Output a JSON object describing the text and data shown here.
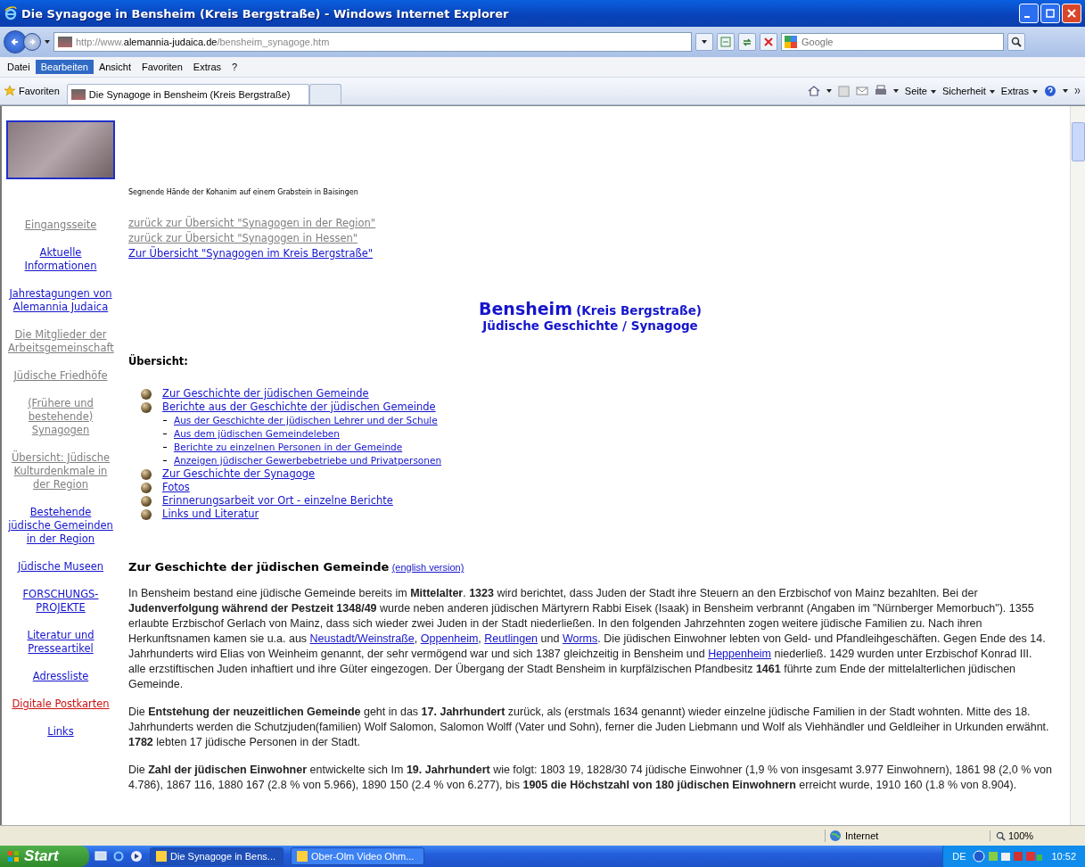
{
  "window": {
    "title": "Die Synagoge in Bensheim (Kreis Bergstraße) - Windows Internet Explorer"
  },
  "address": {
    "prefix": "http://www.",
    "domain": "alemannia-judaica.de",
    "path": "/bensheim_synagoge.htm"
  },
  "search": {
    "placeholder": "Google"
  },
  "menu": [
    {
      "label": "Datei",
      "selected": false
    },
    {
      "label": "Bearbeiten",
      "selected": true
    },
    {
      "label": "Ansicht",
      "selected": false
    },
    {
      "label": "Favoriten",
      "selected": false
    },
    {
      "label": "Extras",
      "selected": false
    },
    {
      "label": "?",
      "selected": false
    }
  ],
  "favorites": {
    "label": "Favoriten",
    "tab": "Die Synagoge in Bensheim (Kreis Bergstraße)"
  },
  "command_bar": [
    "Seite",
    "Sicherheit",
    "Extras"
  ],
  "sidebar": {
    "items": [
      {
        "label": "Eingangsseite",
        "color": "#808080"
      },
      {
        "label": "Aktuelle Informationen",
        "color": "#1515cc"
      },
      {
        "label": "Jahrestagungen von Alemannia Judaica",
        "color": "#1515cc"
      },
      {
        "label": "Die Mitglieder der Arbeitsgemeinschaft",
        "color": "#808080"
      },
      {
        "label": "Jüdische Friedhöfe",
        "color": "#808080"
      },
      {
        "label": "(Frühere und bestehende) Synagogen",
        "color": "#808080"
      },
      {
        "label": "Übersicht: Jüdische Kulturdenkmale in der Region",
        "color": "#808080"
      },
      {
        "label": "Bestehende jüdische Gemeinden in der Region",
        "color": "#1515cc"
      },
      {
        "label": "Jüdische Museen",
        "color": "#1515cc"
      },
      {
        "label": "FORSCHUNGS-PROJEKTE",
        "color": "#1515cc"
      },
      {
        "label": "Literatur und Presseartikel",
        "color": "#1515cc"
      },
      {
        "label": "Adressliste",
        "color": "#1515cc"
      },
      {
        "label": "Digitale Postkarten",
        "color": "#cc1111"
      },
      {
        "label": "Links",
        "color": "#1515cc"
      }
    ]
  },
  "photo_caption": "Segnende Hände der Kohanim auf einem Grabstein in Baisingen",
  "back_links": [
    {
      "label": "zurück zur Übersicht \"Synagogen in der Region\"",
      "color": "#808080"
    },
    {
      "label": "zurück zur Übersicht \"Synagogen in Hessen\"",
      "color": "#808080"
    },
    {
      "label": "Zur Übersicht \"Synagogen im Kreis Bergstraße\"",
      "color": "#1515cc"
    }
  ],
  "heading": {
    "title": "Bensheim",
    "district": "(Kreis Bergstraße)",
    "subtitle": "Jüdische Geschichte / Synagoge"
  },
  "overview": {
    "title": "Übersicht:",
    "items": [
      {
        "label": "Zur Geschichte der jüdischen Gemeinde"
      },
      {
        "label": "Berichte aus der Geschichte der jüdischen Gemeinde",
        "children": [
          {
            "label": "Aus der Geschichte der jüdischen Lehrer und der Schule"
          },
          {
            "label": "Aus dem jüdischen Gemeindeleben"
          },
          {
            "label": "Berichte zu einzelnen Personen in der Gemeinde"
          },
          {
            "label": "Anzeigen jüdischer Gewerbebetriebe und Privatpersonen"
          }
        ]
      },
      {
        "label": "Zur Geschichte der Synagoge"
      },
      {
        "label": "Fotos"
      },
      {
        "label": "Erinnerungsarbeit vor Ort - einzelne Berichte"
      },
      {
        "label": "Links und Literatur"
      }
    ]
  },
  "section": {
    "title": "Zur Geschichte der jüdischen Gemeinde",
    "link": "(english version)",
    "paragraphs": [
      [
        {
          "kind": "text",
          "text": "In Bensheim bestand eine jüdische Gemeinde bereits im **Mittelalter**. **1323** wird berichtet, dass Juden der Stadt ihre Steuern an den Erzbischof von Mainz bezahlten. Bei der **Judenverfolgung während der Pestzeit 1348/49** wurde neben anderen jüdischen Märtyrern Rabbi Eisek (Isaak) in Bensheim verbrannt (Angaben im \"Nürnberger Memorbuch\"). 1355 erlaubte Erzbischof Gerlach von Mainz, dass sich wieder zwei Juden in der Stadt niederließen. In den folgenden Jahrzehnten zogen weitere jüdische Familien zu. Nach ihren Herkunftsnamen kamen sie u.a. aus "
        },
        {
          "kind": "link",
          "text": "Neustadt/Weinstraße"
        },
        {
          "kind": "text",
          "text": ", "
        },
        {
          "kind": "link",
          "text": "Oppenheim"
        },
        {
          "kind": "text",
          "text": ", "
        },
        {
          "kind": "link",
          "text": "Reutlingen"
        },
        {
          "kind": "text",
          "text": " und "
        },
        {
          "kind": "link",
          "text": "Worms"
        },
        {
          "kind": "text",
          "text": ". Die jüdischen Einwohner lebten von Geld- und Pfandleihgeschäften. Gegen Ende des 14. Jahrhunderts wird Elias von Weinheim genannt, der sehr vermögend war und sich 1387 gleichzeitig in Bensheim und "
        },
        {
          "kind": "link",
          "text": "Heppenheim"
        },
        {
          "kind": "text",
          "text": " niederließ. 1429 wurden unter Erzbischof Konrad III. alle erzstiftischen Juden inhaftiert und ihre Güter eingezogen. Der Übergang der Stadt Bensheim in kurpfälzischen Pfandbesitz **1461** führte zum Ende der mittelalterlichen jüdischen Gemeinde."
        }
      ],
      [
        {
          "kind": "text",
          "text": "Die **Entstehung der neuzeitlichen Gemeinde** geht in das **17. Jahrhundert** zurück, als (erstmals 1634 genannt) wieder einzelne jüdische Familien in der Stadt wohnten. Mitte des 18. Jahrhunderts werden die Schutzjuden(familien) Wolf Salomon, Salomon Wolff (Vater und Sohn), ferner die Juden Liebmann und Wolf als Viehhändler und Geldleiher in Urkunden erwähnt. **1782** lebten 17 jüdische Personen in der Stadt."
        }
      ],
      [
        {
          "kind": "text",
          "text": "Die **Zahl der jüdischen Einwohner** entwickelte sich Im **19. Jahrhundert** wie folgt: 1803 19, 1828/30 74 jüdische Einwohner (1,9 % von insgesamt 3.977 Einwohnern), 1861 98 (2,0 % von 4.786), 1867 116, 1880 167 (2.8 % von 5.966), 1890 150 (2.4 % von 6.277), bis **1905 die Höchstzahl von 180 jüdischen Einwohnern** erreicht wurde, 1910 160 (1.8 % von 8.904)."
        }
      ]
    ]
  },
  "status_bar": {
    "zone": "Internet",
    "zoom": "100%"
  },
  "taskbar": {
    "start": "Start",
    "tasks": [
      {
        "label": "Die Synagoge in Bens...",
        "selected": true
      },
      {
        "label": "Ober-Olm Video Ohm...",
        "selected": false
      }
    ],
    "language": "DE",
    "time": "10:52"
  }
}
